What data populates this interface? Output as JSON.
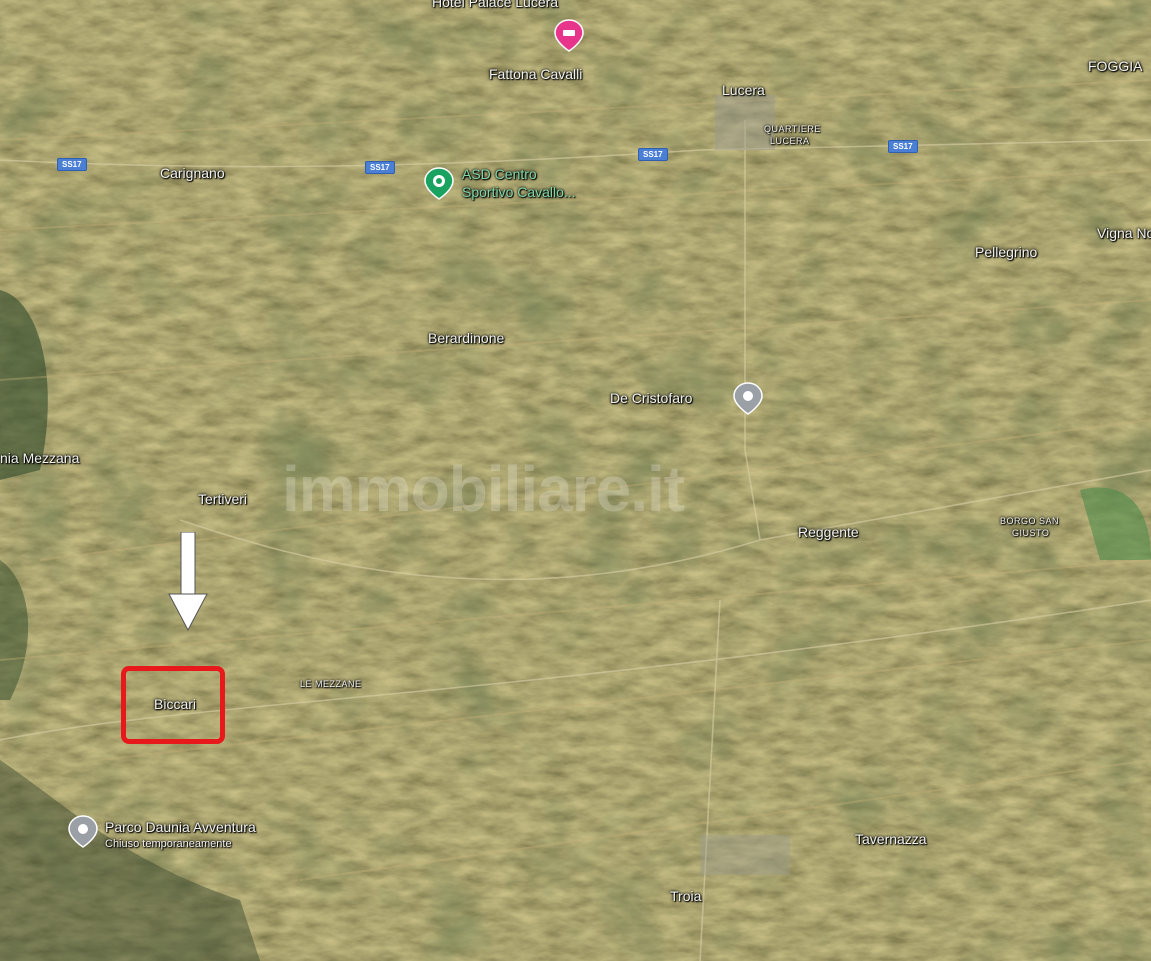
{
  "map": {
    "places": {
      "hotel": "Hotel Palace Lucera",
      "fattona": "Fattona Cavalli",
      "lucera": "Lucera",
      "quartiere": "QUARTIERE",
      "lucera_small": "LUCERA",
      "foggia": "FOGGIA",
      "carignano": "Carignano",
      "asd_line1": "ASD Centro",
      "asd_line2": "Sportivo Cavallo...",
      "vigna": "Vigna No",
      "pellegrino": "Pellegrino",
      "berardinone": "Berardinone",
      "decristofaro": "De Cristofaro",
      "mezzana": "nia Mezzana",
      "tertiveri": "Tertiveri",
      "reggente": "Reggente",
      "borgo_line1": "BORGO SAN",
      "borgo_line2": "GIUSTO",
      "lemezzane": "LE MEZZANE",
      "biccari": "Biccari",
      "parco_line1": "Parco Daunia Avventura",
      "parco_line2": "Chiuso temporaneamente",
      "tavernazza": "Tavernazza",
      "troia": "Troia"
    },
    "roads": [
      "SS17",
      "SS17",
      "SS17",
      "SS17"
    ],
    "watermark": "immobiliare.it",
    "icons": {
      "hotel_pin": "hotel-pin-icon",
      "sport_pin": "sport-center-pin-icon",
      "place_pin": "place-pin-icon",
      "park_pin": "park-pin-icon",
      "arrow": "arrow-down-icon"
    },
    "colors": {
      "highlight": "#e8191b",
      "road_shield": "#4a7fd4",
      "hotel_pin": "#e8358c",
      "sport_pin": "#1aa260",
      "place_pin": "#9aa0a6"
    }
  }
}
